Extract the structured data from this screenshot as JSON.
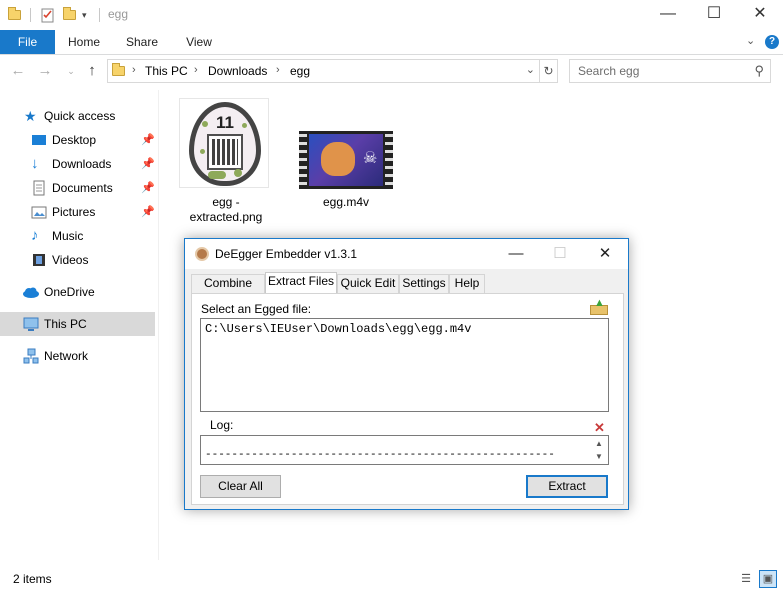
{
  "window": {
    "title": "egg",
    "minimize": "—",
    "maximize": "☐",
    "close": "✕"
  },
  "ribbon": {
    "tabs": [
      "File",
      "Home",
      "Share",
      "View"
    ],
    "expand_icon": "chevron-down-icon",
    "help_label": "?"
  },
  "address": {
    "crumbs": [
      "This PC",
      "Downloads",
      "egg"
    ],
    "search_placeholder": "Search egg"
  },
  "nav": {
    "items": [
      {
        "label": "Quick access",
        "icon": "star-icon"
      },
      {
        "label": "Desktop",
        "icon": "desktop-icon",
        "pinned": true
      },
      {
        "label": "Downloads",
        "icon": "download-icon",
        "pinned": true
      },
      {
        "label": "Documents",
        "icon": "documents-icon",
        "pinned": true
      },
      {
        "label": "Pictures",
        "icon": "pictures-icon",
        "pinned": true
      },
      {
        "label": "Music",
        "icon": "music-icon"
      },
      {
        "label": "Videos",
        "icon": "videos-icon"
      },
      {
        "label": "OneDrive",
        "icon": "cloud-icon"
      },
      {
        "label": "This PC",
        "icon": "computer-icon",
        "selected": true
      },
      {
        "label": "Network",
        "icon": "network-icon"
      }
    ]
  },
  "files": [
    {
      "name_line1": "egg -",
      "name_line2": "extracted.png",
      "egg_number": "11"
    },
    {
      "name": "egg.m4v"
    }
  ],
  "status": {
    "item_count": "2 items"
  },
  "dialog": {
    "title": "DeEgger Embedder v1.3.1",
    "close": "✕",
    "tabs": [
      "Combine Files",
      "Extract Files",
      "Quick Edit",
      "Settings",
      "Help"
    ],
    "active_tab": "Extract Files",
    "select_label": "Select an Egged file:",
    "file_path": "C:\\Users\\IEUser\\Downloads\\egg\\egg.m4v",
    "log_label": "Log:",
    "log_text": "-----------------------------------------------------",
    "clear_button": "Clear All",
    "extract_button": "Extract"
  },
  "colors": {
    "accent": "#1979ca",
    "selection": "#d9d9d9",
    "folder": "#f7d36a"
  }
}
